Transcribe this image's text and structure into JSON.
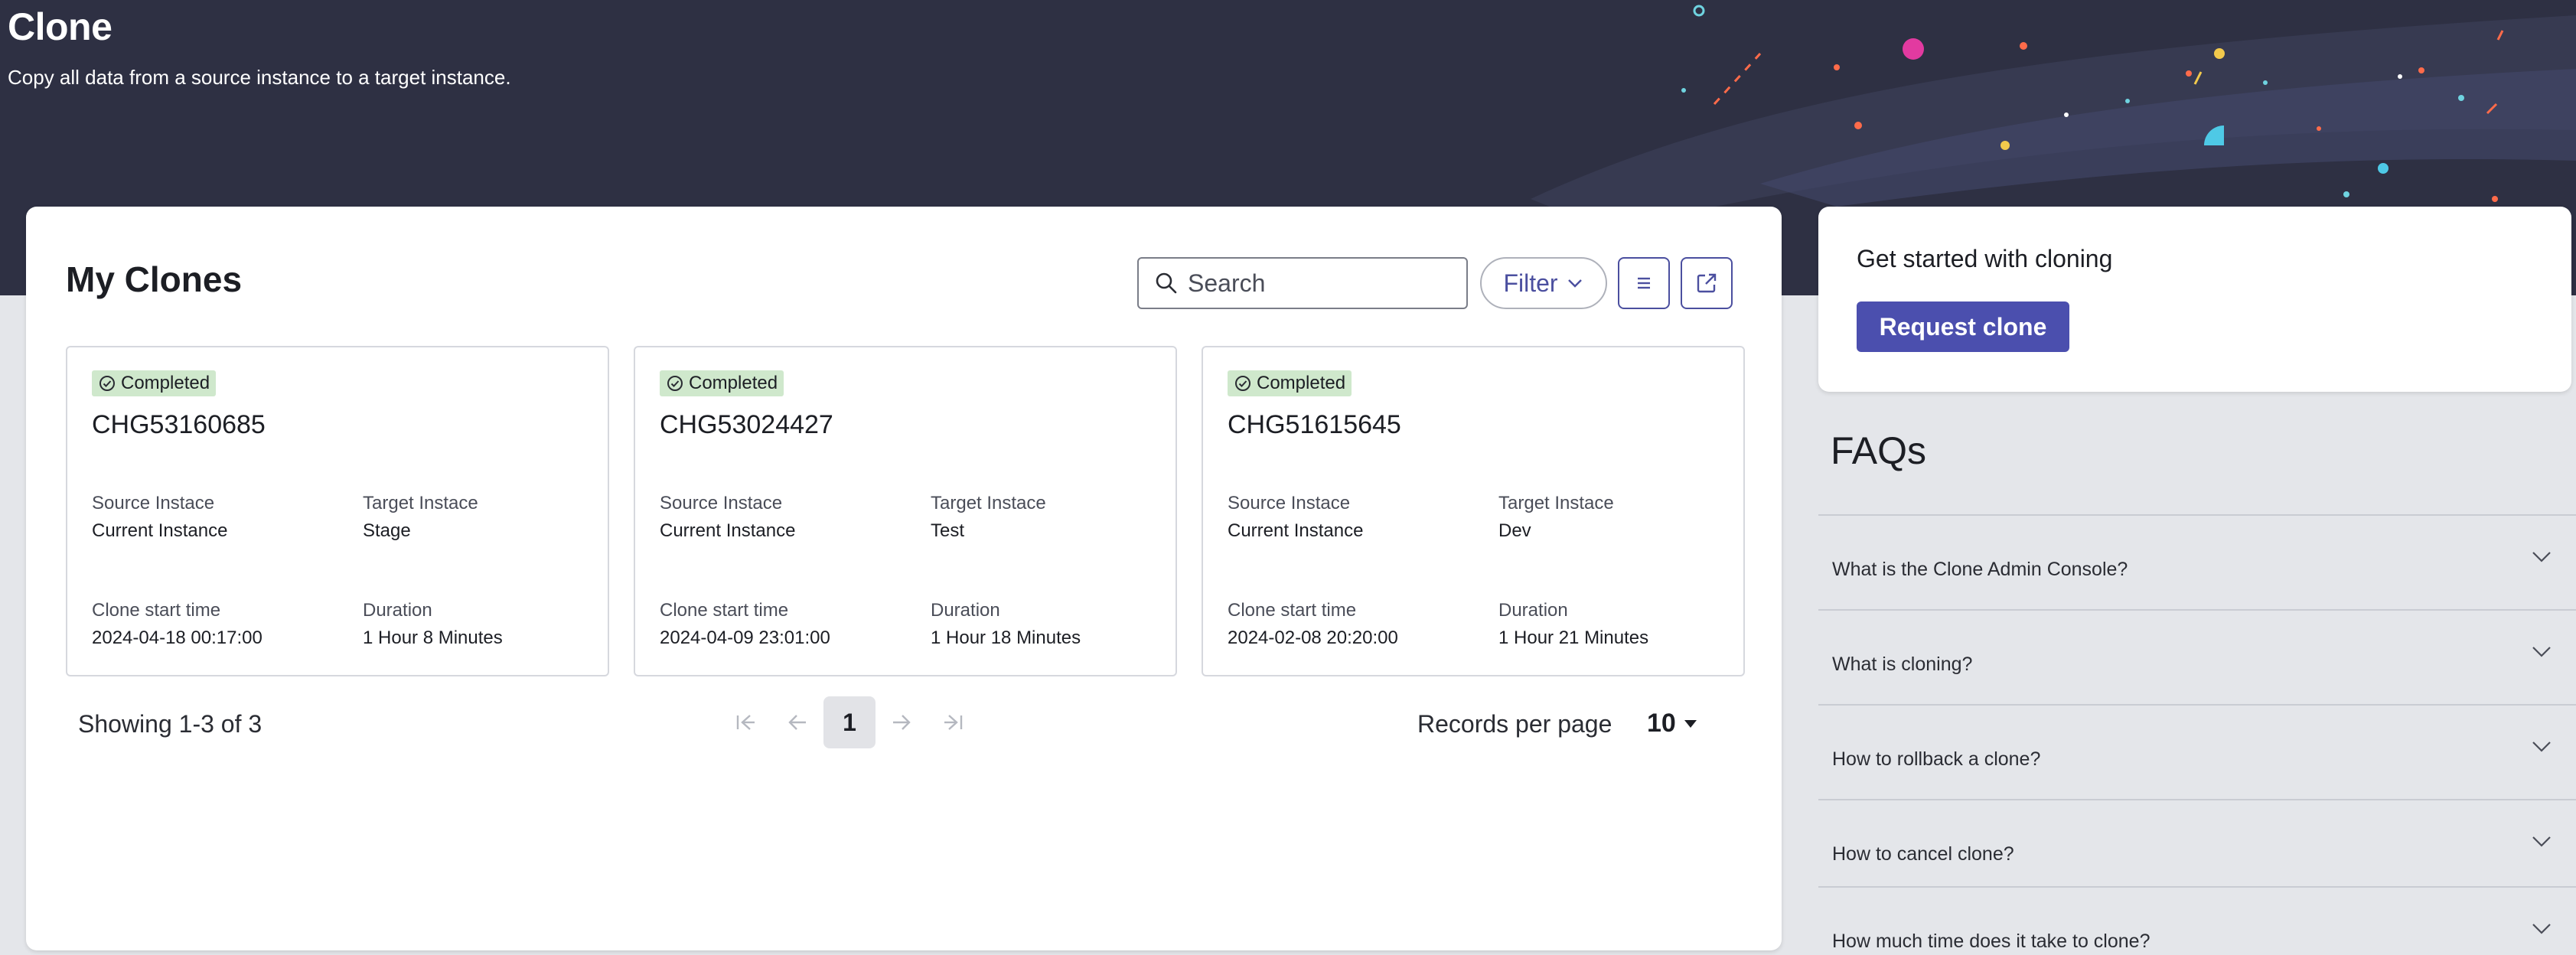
{
  "header": {
    "title": "Clone",
    "subtitle": "Copy all data from a source instance to a target instance."
  },
  "main": {
    "title": "My Clones",
    "search": {
      "placeholder": "Search",
      "icon": "search-icon"
    },
    "filter_label": "Filter",
    "list_view_icon": "list-icon",
    "open_external_icon": "external-link-icon",
    "clones": [
      {
        "status": "Completed",
        "id": "CHG53160685",
        "source_label": "Source Instace",
        "source_value": "Current Instance",
        "target_label": "Target Instace",
        "target_value": "Stage",
        "start_label": "Clone start time",
        "start_value": "2024-04-18 00:17:00",
        "duration_label": "Duration",
        "duration_value": "1 Hour 8 Minutes"
      },
      {
        "status": "Completed",
        "id": "CHG53024427",
        "source_label": "Source Instace",
        "source_value": "Current Instance",
        "target_label": "Target Instace",
        "target_value": "Test",
        "start_label": "Clone start time",
        "start_value": "2024-04-09 23:01:00",
        "duration_label": "Duration",
        "duration_value": "1 Hour 18 Minutes"
      },
      {
        "status": "Completed",
        "id": "CHG51615645",
        "source_label": "Source Instace",
        "source_value": "Current Instance",
        "target_label": "Target Instace",
        "target_value": "Dev",
        "start_label": "Clone start time",
        "start_value": "2024-02-08 20:20:00",
        "duration_label": "Duration",
        "duration_value": "1 Hour 21 Minutes"
      }
    ],
    "pagination": {
      "showing": "Showing 1-3 of 3",
      "current_page": "1",
      "records_per_page_label": "Records per page",
      "records_per_page_value": "10"
    }
  },
  "get_started": {
    "title": "Get started with cloning",
    "button_label": "Request clone"
  },
  "faqs": {
    "title": "FAQs",
    "items": [
      "What is the Clone Admin Console?",
      "What is cloning?",
      "How to rollback a clone?",
      "How to cancel clone?",
      "How much time does it take to clone?"
    ]
  },
  "colors": {
    "hero_bg": "#2e3043",
    "accent": "#4b4fae",
    "status_completed_bg": "#cfe8cc",
    "page_bg": "#e4e6ea"
  }
}
